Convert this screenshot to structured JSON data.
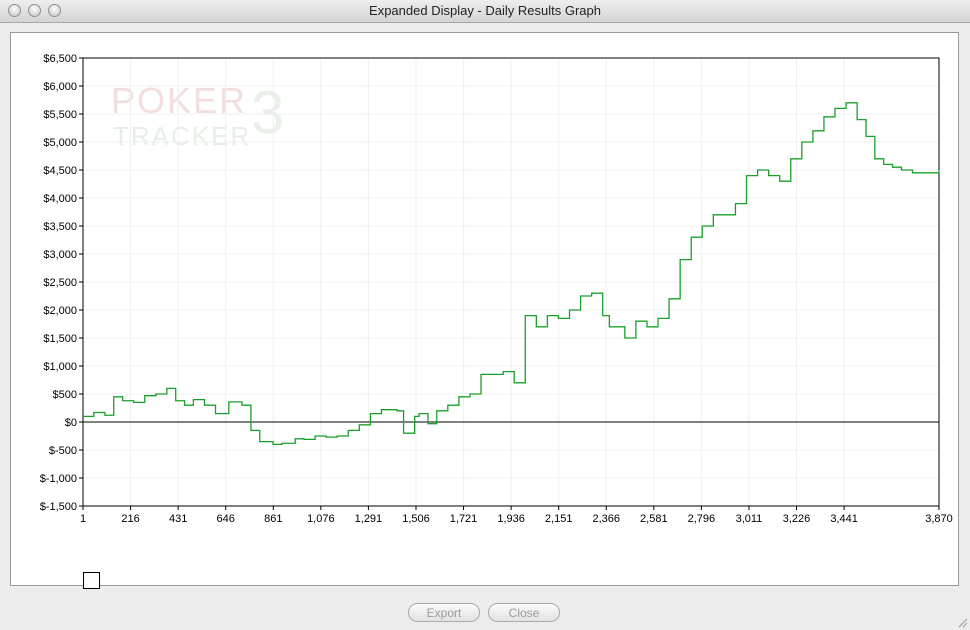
{
  "window": {
    "title": "Expanded Display - Daily Results Graph"
  },
  "watermark": {
    "line1": "POKER",
    "line2": "TRACKER",
    "badge": "3"
  },
  "buttons": {
    "export": "Export",
    "close": "Close"
  },
  "chart_data": {
    "type": "line",
    "title": "",
    "xlabel": "",
    "ylabel": "",
    "xlim": [
      1,
      3870
    ],
    "ylim": [
      -1500,
      6500
    ],
    "x_ticks": [
      1,
      216,
      431,
      646,
      861,
      1076,
      1291,
      1506,
      1721,
      1936,
      2151,
      2366,
      2581,
      2796,
      3011,
      3226,
      3441,
      3870
    ],
    "x_tick_labels": [
      "1",
      "216",
      "431",
      "646",
      "861",
      "1,076",
      "1,291",
      "1,506",
      "1,721",
      "1,936",
      "2,151",
      "2,366",
      "2,581",
      "2,796",
      "3,011",
      "3,226",
      "3,441",
      "3,870"
    ],
    "y_ticks": [
      -1500,
      -1000,
      -500,
      0,
      500,
      1000,
      1500,
      2000,
      2500,
      3000,
      3500,
      4000,
      4500,
      5000,
      5500,
      6000,
      6500
    ],
    "y_tick_labels": [
      "$-1,500",
      "$-1,000",
      "$-500",
      "$0",
      "$500",
      "$1,000",
      "$1,500",
      "$2,000",
      "$2,500",
      "$3,000",
      "$3,500",
      "$4,000",
      "$4,500",
      "$5,000",
      "$5,500",
      "$6,000",
      "$6,500"
    ],
    "grid": true,
    "zero_line": true,
    "line_color": "#1aa02a",
    "series": [
      {
        "x": [
          1,
          50,
          100,
          140,
          180,
          230,
          280,
          330,
          380,
          420,
          460,
          500,
          550,
          600,
          660,
          720,
          760,
          800,
          860,
          900,
          960,
          1000,
          1050,
          1100,
          1150,
          1200,
          1250,
          1300,
          1350,
          1420,
          1450,
          1500,
          1520,
          1560,
          1600,
          1650,
          1700,
          1750,
          1800,
          1850,
          1900,
          1950,
          2000,
          2050,
          2100,
          2150,
          2200,
          2250,
          2300,
          2350,
          2380,
          2420,
          2450,
          2500,
          2550,
          2600,
          2650,
          2700,
          2750,
          2800,
          2850,
          2900,
          2950,
          3000,
          3050,
          3100,
          3150,
          3200,
          3250,
          3300,
          3350,
          3400,
          3450,
          3500,
          3540,
          3580,
          3620,
          3660,
          3700,
          3750,
          3800,
          3870
        ],
        "y": [
          100,
          170,
          120,
          450,
          380,
          350,
          470,
          500,
          600,
          380,
          300,
          400,
          300,
          150,
          360,
          300,
          -150,
          -350,
          -400,
          -380,
          -300,
          -310,
          -250,
          -270,
          -250,
          -150,
          -50,
          150,
          220,
          200,
          -200,
          100,
          150,
          -30,
          200,
          300,
          450,
          500,
          850,
          850,
          900,
          700,
          1900,
          1700,
          1900,
          1850,
          2000,
          2250,
          2300,
          1900,
          1700,
          1700,
          1500,
          1800,
          1700,
          1850,
          2200,
          2900,
          3300,
          3500,
          3700,
          3700,
          3900,
          4400,
          4500,
          4400,
          4300,
          4700,
          5000,
          5200,
          5450,
          5600,
          5700,
          5400,
          5100,
          4700,
          4600,
          4550,
          4500,
          4450,
          4450,
          4500
        ]
      }
    ]
  }
}
